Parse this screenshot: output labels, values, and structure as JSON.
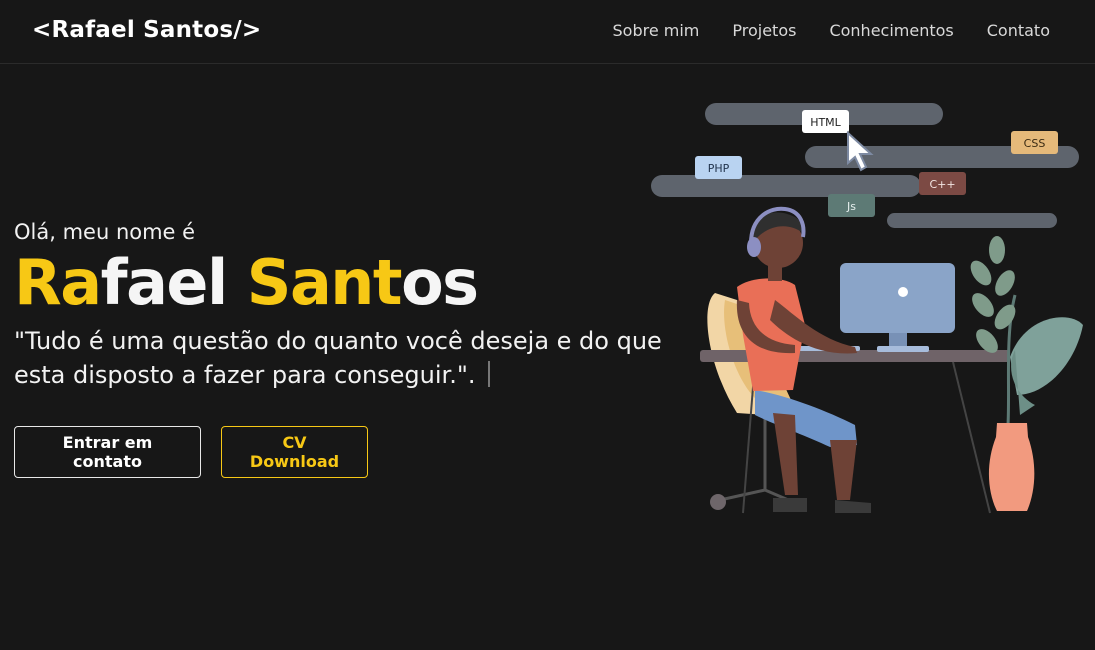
{
  "header": {
    "logo": "<Rafael Santos/>",
    "nav": [
      "Sobre mim",
      "Projetos",
      "Conhecimentos",
      "Contato"
    ]
  },
  "hero": {
    "greeting": "Olá, meu nome é",
    "name_parts": [
      "Ra",
      "fael ",
      "Sant",
      "os"
    ],
    "quote": "\"Tudo é uma questão do quanto você deseja e do que esta disposto a fazer para conseguir.\".",
    "buttons": {
      "contact": "Entrar em contato",
      "cv": "CV Download"
    }
  },
  "illustration": {
    "tags": [
      "HTML",
      "CSS",
      "PHP",
      "C++",
      "Js"
    ]
  },
  "colors": {
    "background": "#171717",
    "accent": "#f7c815",
    "text": "#f2f2f2"
  }
}
